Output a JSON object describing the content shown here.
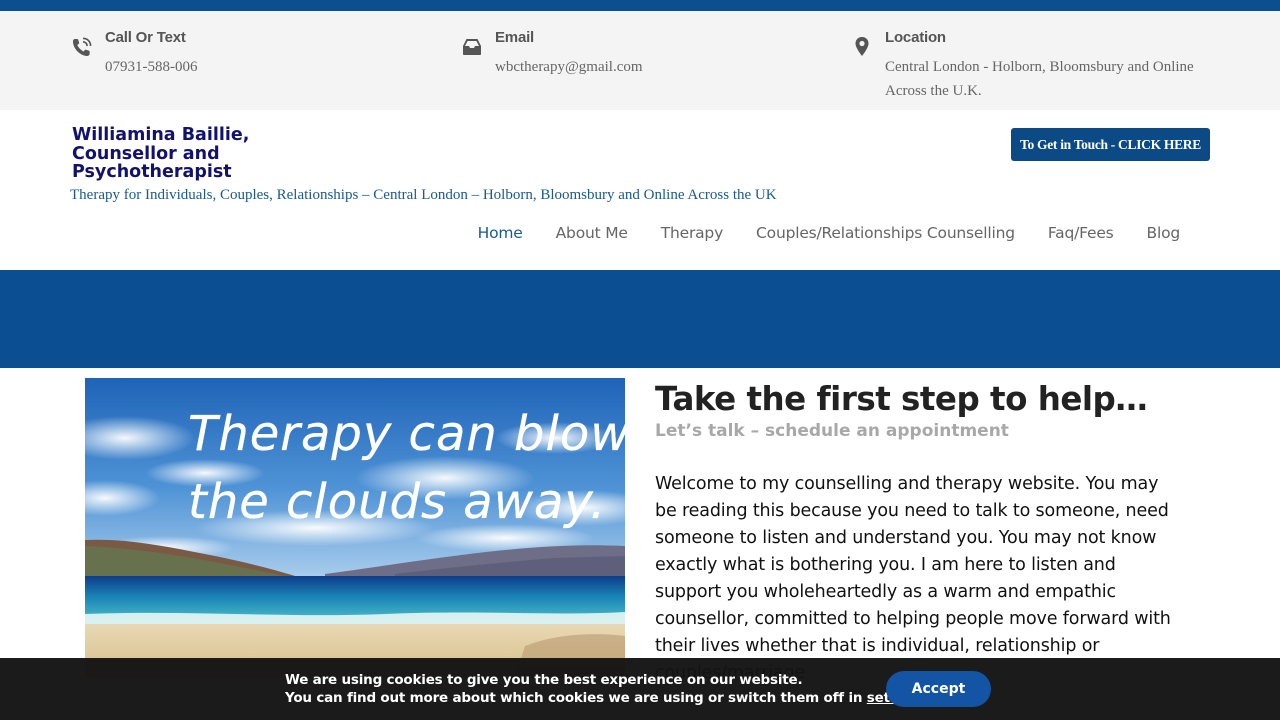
{
  "contact": {
    "call": {
      "label": "Call Or Text",
      "value": "07931-588-006",
      "icon": "phone-icon"
    },
    "email": {
      "label": "Email",
      "value": "wbctherapy@gmail.com",
      "icon": "inbox-icon"
    },
    "location": {
      "label": "Location",
      "line1": "Central London - Holborn, Bloomsbury and Online",
      "line2": "Across the U.K.",
      "icon": "map-pin-icon"
    }
  },
  "brand": {
    "line1": "Williamina Baillie,",
    "line2": "Counsellor and",
    "line3": "Psychotherapist",
    "tagline": "Therapy for Individuals, Couples, Relationships – Central London – Holborn, Bloomsbury and Online Across the UK",
    "color": "#12126e"
  },
  "cta": {
    "label": "To Get in Touch - CLICK HERE"
  },
  "nav": {
    "items": [
      {
        "label": "Home"
      },
      {
        "label": "About Me"
      },
      {
        "label": "Therapy"
      },
      {
        "label": "Couples/Relationships Counselling"
      },
      {
        "label": "Faq/Fees"
      },
      {
        "label": "Blog"
      }
    ],
    "active": "Home"
  },
  "hero": {
    "line1": "Therapy can blow",
    "line2": "the clouds away."
  },
  "content": {
    "heading": "Take the first step to help…",
    "subheading": "Let’s talk – schedule an appointment",
    "body": "Welcome to my counselling and therapy website. You may be reading this because you need to talk to someone, need someone to listen and understand you. You may not know exactly what is bothering you. I am here to listen and support you wholeheartedly as a warm and empathic counsellor, committed to helping people move forward with their lives whether that is individual, relationship or couples/marriage"
  },
  "cookie": {
    "line1": "We are using cookies to give you the best experience on our website.",
    "line2_prefix": "You can find out more about which cookies we are using or switch them off in",
    "link": "settings",
    "line2_suffix": ".",
    "accept": "Accept"
  },
  "colors": {
    "accent": "#0c4e8f",
    "banner": "#0b4e92",
    "cookie_bg": "#141414",
    "accept_bg": "#1454a4"
  }
}
